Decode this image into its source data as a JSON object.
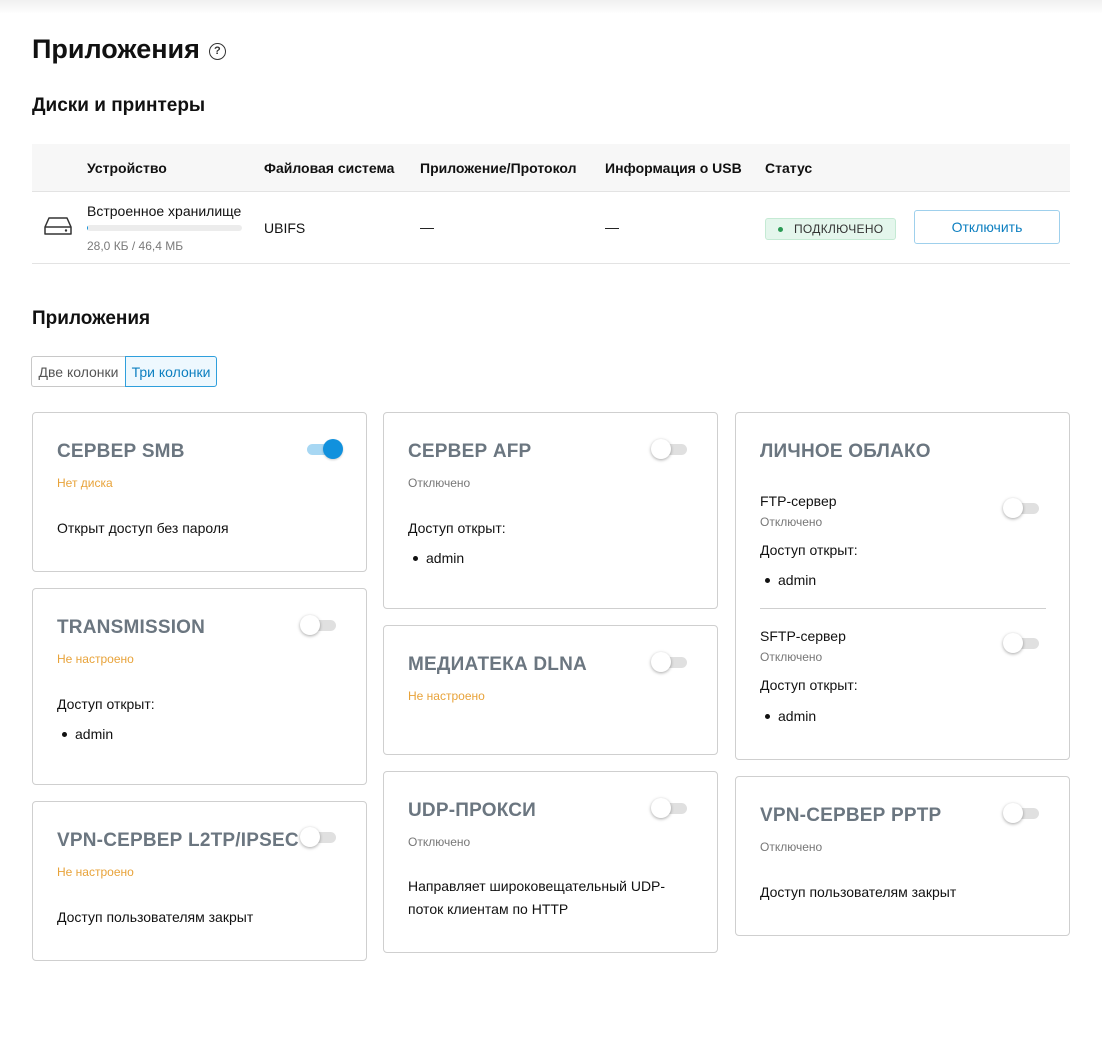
{
  "page": {
    "title": "Приложения"
  },
  "disks": {
    "title": "Диски и принтеры",
    "columns": [
      "Устройство",
      "Файловая система",
      "Приложение/Протокол",
      "Информация о USB",
      "Статус"
    ],
    "rows": [
      {
        "device": "Встроенное хранилище",
        "usage": "28,0 КБ / 46,4 МБ",
        "usage_fraction": 0.0006,
        "fs": "UBIFS",
        "protocol": "—",
        "usb": "—",
        "status": "ПОДКЛЮЧЕНО",
        "action": "Отключить"
      }
    ]
  },
  "apps": {
    "title": "Приложения",
    "view_options": [
      "Две колонки",
      "Три колонки"
    ],
    "selected_view": "Три колонки",
    "cards": {
      "smb": {
        "title": "СЕРВЕР SMB",
        "status": "Нет диска",
        "enabled": true,
        "text": "Открыт доступ без пароля"
      },
      "transmission": {
        "title": "TRANSMISSION",
        "status": "Не настроено",
        "enabled": false,
        "access_label": "Доступ открыт:",
        "users": [
          "admin"
        ]
      },
      "l2tp": {
        "title": "VPN-СЕРВЕР L2TP/IPSEC",
        "status": "Не настроено",
        "enabled": false,
        "text": "Доступ пользователям закрыт"
      },
      "afp": {
        "title": "СЕРВЕР AFP",
        "status": "Отключено",
        "enabled": false,
        "access_label": "Доступ открыт:",
        "users": [
          "admin"
        ]
      },
      "dlna": {
        "title": "МЕДИАТЕКА DLNA",
        "status": "Не настроено",
        "enabled": false
      },
      "udpxy": {
        "title": "UDP-ПРОКСИ",
        "status": "Отключено",
        "enabled": false,
        "text_line1": "Направляет широковещательный UDP-",
        "text_line2": "поток клиентам по HTTP"
      },
      "cloud": {
        "title": "ЛИЧНОЕ ОБЛАКО",
        "ftp": {
          "label": "FTP-сервер",
          "status": "Отключено",
          "enabled": false,
          "access_label": "Доступ открыт:",
          "users": [
            "admin"
          ]
        },
        "sftp": {
          "label": "SFTP-сервер",
          "status": "Отключено",
          "enabled": false,
          "access_label": "Доступ открыт:",
          "users": [
            "admin"
          ]
        }
      },
      "pptp": {
        "title": "VPN-СЕРВЕР PPTP",
        "status": "Отключено",
        "enabled": false,
        "text": "Доступ пользователям закрыт"
      }
    }
  },
  "colors": {
    "accent": "#1191dd",
    "warning": "#e8a33a",
    "connected_badge": "#e4f6ec"
  }
}
